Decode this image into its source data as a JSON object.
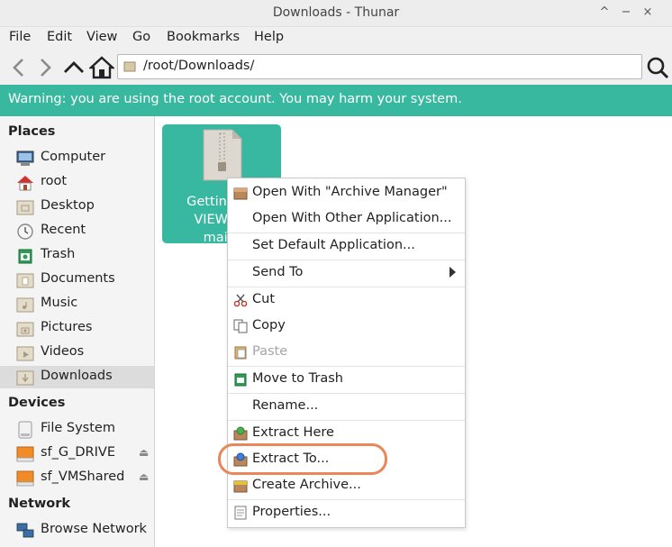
{
  "window": {
    "title": "Downloads - Thunar",
    "title_fragment": "...",
    "controls": [
      "^",
      "−",
      "×"
    ]
  },
  "menubar": [
    "File",
    "Edit",
    "View",
    "Go",
    "Bookmarks",
    "Help"
  ],
  "toolbar": {
    "location": "/root/Downloads/"
  },
  "warning": "Warning: you are using the root account. You may harm your system.",
  "sidebar": {
    "places_title": "Places",
    "places": [
      {
        "label": "Computer",
        "icon": "computer-icon"
      },
      {
        "label": "root",
        "icon": "home-icon"
      },
      {
        "label": "Desktop",
        "icon": "desktop-folder-icon"
      },
      {
        "label": "Recent",
        "icon": "clock-icon"
      },
      {
        "label": "Trash",
        "icon": "trash-icon"
      },
      {
        "label": "Documents",
        "icon": "documents-folder-icon"
      },
      {
        "label": "Music",
        "icon": "music-folder-icon"
      },
      {
        "label": "Pictures",
        "icon": "pictures-folder-icon"
      },
      {
        "label": "Videos",
        "icon": "videos-folder-icon"
      },
      {
        "label": "Downloads",
        "icon": "downloads-folder-icon",
        "selected": true
      }
    ],
    "devices_title": "Devices",
    "devices": [
      {
        "label": "File System",
        "icon": "drive-icon"
      },
      {
        "label": "sf_G_DRIVE",
        "icon": "removable-drive-icon",
        "eject": "⏏"
      },
      {
        "label": "sf_VMShared",
        "icon": "removable-drive-icon",
        "eject": "⏏"
      }
    ],
    "network_title": "Network",
    "network": [
      {
        "label": "Browse Network",
        "icon": "network-icon"
      }
    ]
  },
  "file": {
    "name_line1": "GettingSta",
    "name_line2": "VIEW1-E",
    "name_line3": "main.",
    "icon": "zip-archive-icon"
  },
  "context_menu": {
    "items": [
      {
        "label": "Open With \"Archive Manager\"",
        "icon": "archive-manager-icon"
      },
      {
        "label": "Open With Other Application..."
      },
      {
        "label": "Set Default Application..."
      },
      {
        "label": "Send To",
        "submenu": true
      },
      {
        "label": "Cut",
        "icon": "scissors-icon"
      },
      {
        "label": "Copy",
        "icon": "copy-icon"
      },
      {
        "label": "Paste",
        "icon": "paste-icon",
        "disabled": true
      },
      {
        "label": "Move to Trash",
        "icon": "trash-icon"
      },
      {
        "label": "Rename..."
      },
      {
        "label": "Extract Here",
        "icon": "extract-here-icon"
      },
      {
        "label": "Extract To...",
        "icon": "extract-to-icon",
        "highlighted": true
      },
      {
        "label": "Create Archive...",
        "icon": "create-archive-icon"
      },
      {
        "label": "Properties...",
        "icon": "properties-icon"
      }
    ]
  },
  "colors": {
    "accent": "#37b89f",
    "highlight_ring": "#e8875a"
  }
}
